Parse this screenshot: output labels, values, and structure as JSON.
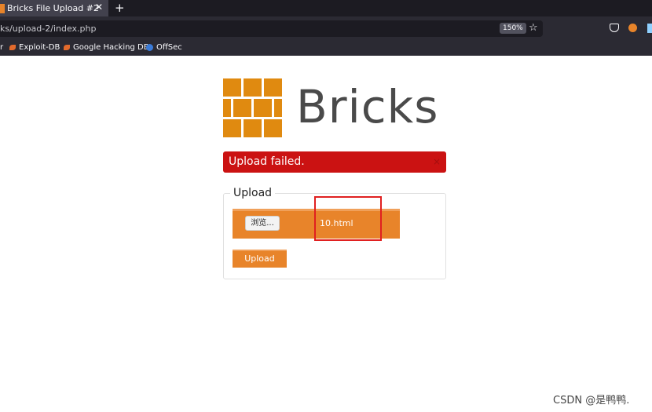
{
  "browser": {
    "tab_title": "Bricks File Upload #2",
    "url": "ks/upload-2/index.php",
    "zoom": "150%",
    "bookmarks": [
      "r",
      "Exploit-DB",
      "Google Hacking DB",
      "OffSec"
    ]
  },
  "page": {
    "brand": "Bricks",
    "alert": "Upload failed.",
    "alert_close": "×",
    "legend": "Upload",
    "browse_label": "浏览...",
    "filename": "10.html",
    "upload_label": "Upload"
  },
  "watermark": "CSDN @是鸭鸭.",
  "colors": {
    "accent": "#e8842a",
    "alert": "#cb1212",
    "highlight": "#e02020"
  }
}
